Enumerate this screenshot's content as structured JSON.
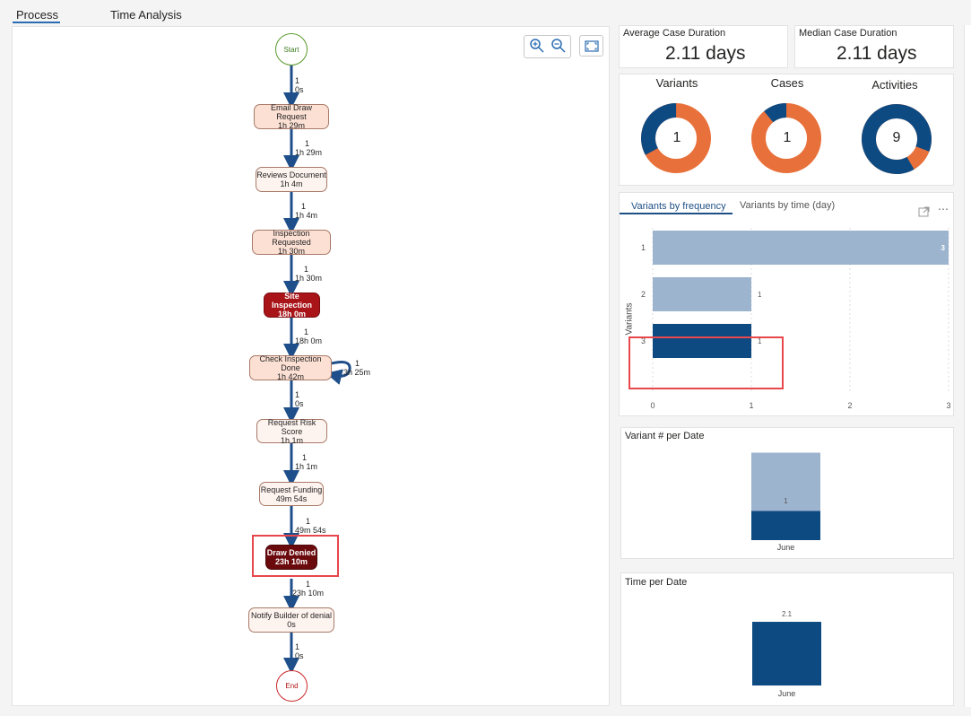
{
  "tabs": [
    {
      "label": "Process",
      "active": true
    },
    {
      "label": "Time Analysis",
      "active": false
    }
  ],
  "process_map": {
    "start_label": "Start",
    "end_label": "End",
    "nodes": [
      {
        "name": "Email Draw Request",
        "time": "1h 29m"
      },
      {
        "name": "Reviews Document",
        "time": "1h 4m"
      },
      {
        "name": "Inspection Requested",
        "time": "1h 30m"
      },
      {
        "name": "Site Inspection",
        "time": "18h 0m"
      },
      {
        "name": "Check Inspection Done",
        "time": "1h 42m"
      },
      {
        "name": "Request Risk Score",
        "time": "1h 1m"
      },
      {
        "name": "Request Funding",
        "time": "49m 54s"
      },
      {
        "name": "Draw Denied",
        "time": "23h 10m"
      },
      {
        "name": "Notify Builder of denial",
        "time": "0s"
      }
    ],
    "edges": [
      {
        "count": "1",
        "time": "0s"
      },
      {
        "count": "1",
        "time": "1h 29m"
      },
      {
        "count": "1",
        "time": "1h 4m"
      },
      {
        "count": "1",
        "time": "1h 30m"
      },
      {
        "count": "1",
        "time": "18h 0m"
      },
      {
        "count": "1",
        "time": "0s"
      },
      {
        "count": "1",
        "time": "1h 1m"
      },
      {
        "count": "1",
        "time": "49m 54s"
      },
      {
        "count": "1",
        "time": "23h 10m"
      },
      {
        "count": "1",
        "time": "0s"
      }
    ],
    "loop": {
      "count": "1",
      "time": "3h 25m"
    },
    "toolbar": {
      "zoom_in": "zoom-in-icon",
      "zoom_out": "zoom-out-icon",
      "fit": "fit-screen-icon"
    }
  },
  "kpis": {
    "avg_title": "Average Case Duration",
    "avg_value": "2.11 days",
    "median_title": "Median Case Duration",
    "median_value": "2.11 days"
  },
  "donuts": [
    {
      "title": "Variants",
      "value": "1",
      "fraction_blue": 0.33
    },
    {
      "title": "Cases",
      "value": "1",
      "fraction_blue": 0.11
    },
    {
      "title": "Activities",
      "value": "9",
      "fraction_blue": 0.89
    }
  ],
  "colors": {
    "blue": "#0e4a82",
    "orange": "#e8703a",
    "lightblue": "#9db4cf",
    "highlight": "#e8474c"
  },
  "variants_panel": {
    "tab_frequency": "Variants by frequency",
    "tab_time": "Variants by time (day)",
    "y_axis_label": "Variants",
    "expand_icon": "expand-icon",
    "more_icon": "more-icon"
  },
  "chart_data": [
    {
      "type": "bar",
      "orientation": "horizontal",
      "categories": [
        "1",
        "2",
        "3"
      ],
      "values": [
        3,
        1,
        1
      ],
      "data_labels": [
        "3",
        "1",
        "1"
      ],
      "x_ticks": [
        "0",
        "1",
        "2",
        "3"
      ],
      "xlim": [
        0,
        3
      ],
      "ylabel": "Variants",
      "selected": "3"
    },
    {
      "type": "bar",
      "title": "Variant # per Date",
      "categories": [
        "June"
      ],
      "series": [
        {
          "values": [
            2
          ],
          "color": "#9db4cf"
        },
        {
          "values": [
            1
          ],
          "color": "#0e4a82"
        }
      ],
      "data_label": "1"
    },
    {
      "type": "bar",
      "title": "Time per Date",
      "categories": [
        "June"
      ],
      "values": [
        2.1
      ],
      "data_label": "2.1"
    }
  ]
}
